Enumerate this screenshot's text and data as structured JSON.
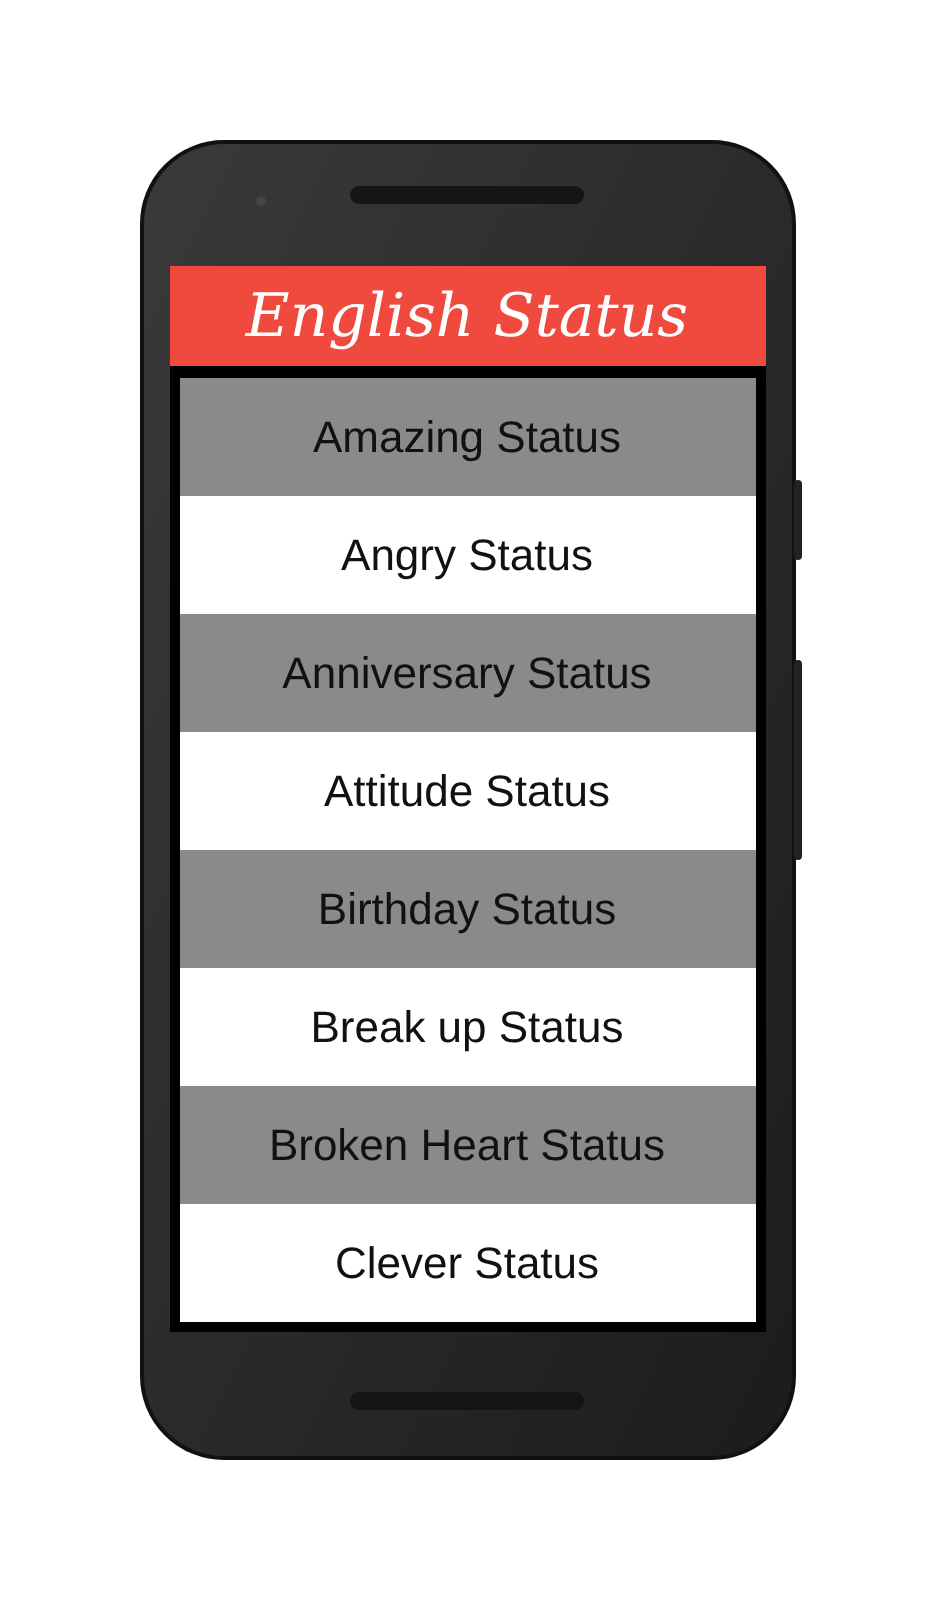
{
  "app_bar": {
    "title": "English Status"
  },
  "list": {
    "items": [
      {
        "label": "Amazing Status"
      },
      {
        "label": "Angry Status"
      },
      {
        "label": "Anniversary Status"
      },
      {
        "label": "Attitude Status"
      },
      {
        "label": "Birthday Status"
      },
      {
        "label": "Break up Status"
      },
      {
        "label": "Broken Heart Status"
      },
      {
        "label": "Clever Status"
      }
    ]
  }
}
